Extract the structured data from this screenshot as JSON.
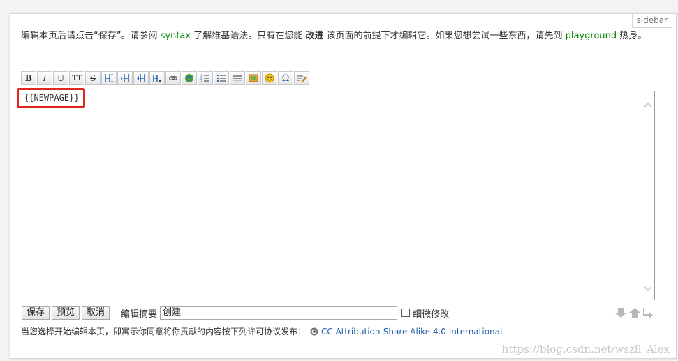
{
  "sidebar_tab": "sidebar",
  "intro": {
    "part1": "编辑本页后请点击“保存”。请参阅 ",
    "syntax_link": "syntax",
    "part2": " 了解维基语法。只有在您能 ",
    "improve": "改进",
    "part3": " 该页面的前提下才编辑它。如果您想尝试一些东西，请先到 ",
    "playground_link": "playground",
    "part4": " 热身。"
  },
  "toolbar": {
    "bold": "B",
    "italic": "I",
    "underline": "U",
    "code": "TT",
    "strike": "S",
    "buttons": [
      "bold-icon",
      "italic-icon",
      "underline-icon",
      "monospace-icon",
      "strikethrough-icon",
      "heading-same-icon",
      "heading-lower-icon",
      "heading-higher-icon",
      "heading-menu-icon",
      "link-icon",
      "external-link-icon",
      "ordered-list-icon",
      "unordered-list-icon",
      "horizontal-rule-icon",
      "image-icon",
      "smiley-icon",
      "special-chars-icon",
      "signature-icon"
    ]
  },
  "editor": {
    "content": "{{NEWPAGE}}"
  },
  "buttons": {
    "save": "保存",
    "preview": "预览",
    "cancel": "取消"
  },
  "summary": {
    "label": "编辑摘要",
    "value": "创建"
  },
  "minor": {
    "label": "细微修改"
  },
  "license": {
    "text": "当您选择开始编辑本页，即寓示你同意将你贡献的内容按下列许可协议发布：",
    "link": "CC Attribution-Share Alike 4.0 International"
  },
  "watermark": "https://blog.csdn.net/wszll_Alex",
  "colors": {
    "link_green": "#008800",
    "link_blue": "#1f5da8",
    "highlight": "#e0261d"
  }
}
